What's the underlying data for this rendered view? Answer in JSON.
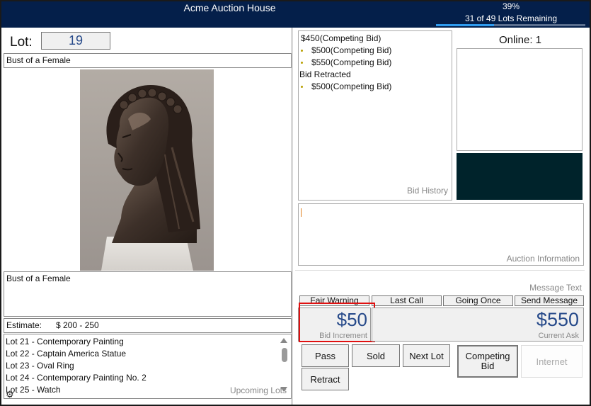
{
  "header": {
    "title": "Acme Auction House",
    "progress_percent": 39,
    "progress_percent_label": "39%",
    "lots_remaining_text": "31 of 49 Lots Remaining",
    "background": "#041f4a",
    "progress_color": "#2e9bef"
  },
  "lot": {
    "label": "Lot:",
    "number": "19",
    "title": "Bust of a Female",
    "description": "Bust of a Female",
    "estimate_label": "Estimate:",
    "estimate_value": "$ 200 - 250",
    "image_icon": "bronze-bust-image"
  },
  "upcoming": {
    "caption": "Upcoming Lots",
    "items": [
      "Lot 21 - Contemporary Painting",
      "Lot 22 - Captain America Statue",
      "Lot 23 - Oval Ring",
      "Lot 24 - Contemporary Painting No. 2",
      "Lot 25 - Watch"
    ]
  },
  "bid_history": {
    "caption": "Bid History",
    "entries": [
      {
        "amount": "$450",
        "note": "(Competing Bid)"
      },
      {
        "amount": "$500",
        "note": "(Competing Bid)"
      },
      {
        "amount": "$550",
        "note": "(Competing Bid)"
      },
      {
        "amount": "",
        "note": "Bid Retracted"
      },
      {
        "amount": "$500",
        "note": "(Competing Bid)"
      }
    ]
  },
  "online": {
    "label": "Online: 1"
  },
  "auction_info": {
    "caption": "Auction Information"
  },
  "message": {
    "caption": "Message Text"
  },
  "quick_buttons": {
    "fair_warning": "Fair Warning",
    "last_call": "Last Call",
    "going_once": "Going Once",
    "send_message": "Send Message"
  },
  "bidding": {
    "increment_value": "$50",
    "increment_caption": "Bid Increment",
    "ask_value": "$550",
    "ask_caption": "Current Ask",
    "highlight_color": "#e01010"
  },
  "actions": {
    "pass": "Pass",
    "sold": "Sold",
    "next_lot": "Next Lot",
    "competing_bid": "Competing Bid",
    "internet": "Internet",
    "retract": "Retract"
  },
  "icons": {
    "settings": "gear-icon"
  }
}
